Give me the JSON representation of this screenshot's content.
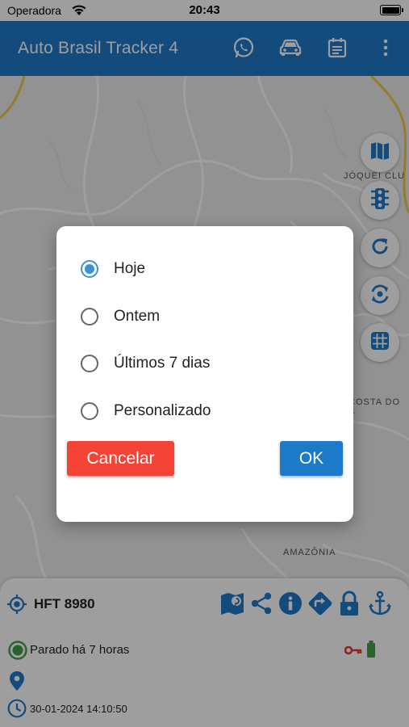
{
  "status_bar": {
    "carrier": "Operadora",
    "time": "20:43"
  },
  "app_bar": {
    "title": "Auto Brasil Tracker 4",
    "actions": [
      "whatsapp-icon",
      "car-icon",
      "calendar-icon",
      "more-vert-icon"
    ]
  },
  "map": {
    "labels": {
      "jockey": "JÓQUEI CLU",
      "costa": "COSTA DO S",
      "amazonia": "AMAZÔNIA"
    },
    "side_buttons": [
      "map-layers-icon",
      "traffic-light-icon",
      "refresh-icon",
      "sync-icon",
      "grid-icon"
    ]
  },
  "vehicle_panel": {
    "plate": "HFT 8980",
    "actions": [
      "map-marker-icon",
      "share-icon",
      "info-icon",
      "directions-icon",
      "lock-icon",
      "anchor-icon"
    ],
    "status": "Parado há 7 horas",
    "datetime": "30-01-2024 14:10:50",
    "colors": {
      "primary": "#1d7ac9",
      "stopped": "#43a047",
      "ignition": "#e53935",
      "battery": "#43a047"
    }
  },
  "dialog": {
    "options": [
      {
        "label": "Hoje",
        "selected": true
      },
      {
        "label": "Ontem",
        "selected": false
      },
      {
        "label": "Últimos 7 dias",
        "selected": false
      },
      {
        "label": "Personalizado",
        "selected": false
      }
    ],
    "cancel_label": "Cancelar",
    "ok_label": "OK",
    "colors": {
      "cancel": "#f44336",
      "ok": "#1d7ac9",
      "radio": "#3d92d6"
    }
  }
}
